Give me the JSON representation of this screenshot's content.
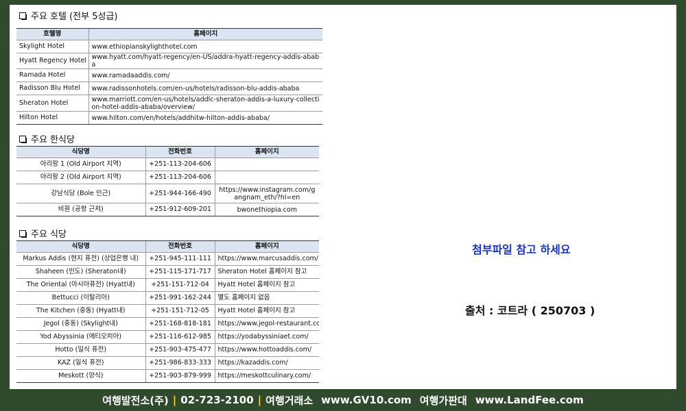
{
  "hotels": {
    "title": "주요 호텔 (전부 5성급)",
    "headers": [
      "호텔명",
      "홈페이지"
    ],
    "rows": [
      [
        "Skylight Hotel",
        "www.ethiopianskylighthotel.com"
      ],
      [
        "Hyatt Regency Hotel",
        "www.hyatt.com/hyatt-regency/en-US/addra-hyatt-regency-addis-ababa"
      ],
      [
        "Ramada Hotel",
        "www.ramadaaddis.com/"
      ],
      [
        "Radisson Blu Hotel",
        "www.radissonhotels.com/en-us/hotels/radisson-blu-addis-ababa"
      ],
      [
        "Sheraton Hotel",
        "www.marriott.com/en-us/hotels/addlc-sheraton-addis-a-luxury-collection-hotel-addis-ababa/overview/"
      ],
      [
        "Hilton Hotel",
        "www.hilton.com/en/hotels/addhitw-hilton-addis-ababa/"
      ]
    ]
  },
  "korean_restaurants": {
    "title": "주요 한식당",
    "headers": [
      "식당명",
      "전화번호",
      "홈페이지"
    ],
    "rows": [
      [
        "아리랑 1 (Old Airport 지역)",
        "+251-113-204-606",
        ""
      ],
      [
        "아리랑 2 (Old Airport 지역)",
        "+251-113-204-606",
        ""
      ],
      [
        "강남식당 (Bole 인근)",
        "+251-944-166-490",
        "https://www.instagram.com/gangnam_eth/?hl=en"
      ],
      [
        "비원 (공항 근처)",
        "+251-912-609-201",
        "bwonethiopia.com"
      ]
    ]
  },
  "restaurants": {
    "title": "주요 식당",
    "headers": [
      "식당명",
      "전화번호",
      "홈페이지"
    ],
    "rows": [
      [
        "Markus Addis (현지 퓨전) (상업은행 내)",
        "+251-945-111-111",
        "https://www.marcusaddis.com/"
      ],
      [
        "Shaheen (인도) (Sheraton내)",
        "+251-115-171-717",
        "Sheraton Hotel 홈페이지 참고"
      ],
      [
        "The Oriental (아시아퓨전) (Hyatt내)",
        "+251-151-712-04",
        "Hyatt Hotel 홈페이지 참고"
      ],
      [
        "Bettucci (이탈리아)",
        "+251-991-162-244",
        "별도 홈페이지 없음"
      ],
      [
        "The Kitchen (중동) (Hyatt내)",
        "+251-151-712-05",
        "Hyatt Hotel 홈페이지 참고"
      ],
      [
        "Jegol (중동) (Skylight내)",
        "+251-168-818-181",
        "https://www.jegol-restaurant.com/"
      ],
      [
        "Yod Abyssinia (에티오피아)",
        "+251-116-612-985",
        "https://yodabyssiniaet.com/"
      ],
      [
        "Hotto (일식 퓨전)",
        "+251-903-475-477",
        "https://www.hottoaddis.com/"
      ],
      [
        "KAZ (일식 퓨전)",
        "+251-986-833-333",
        "https://kazaddis.com/"
      ],
      [
        "Meskott (양식)",
        "+251-903-879-999",
        "https://meskottculinary.com/"
      ]
    ]
  },
  "note": "첨부파일 참고 하세요",
  "source": "출처 : 코트라 ( 250703 )",
  "footer": {
    "company": "여행발전소(주)",
    "phone": "02-723-2100",
    "exchange_label": "여행거래소",
    "exchange_url": "www.GV10.com",
    "price_label": "여행가판대",
    "price_url": "www.LandFee.com",
    "separator": "|"
  },
  "colors": {
    "background": "#2f4a2c",
    "header_fill": "#dbe5f1",
    "note": "#1a34c8",
    "separator": "#ffd21a"
  }
}
